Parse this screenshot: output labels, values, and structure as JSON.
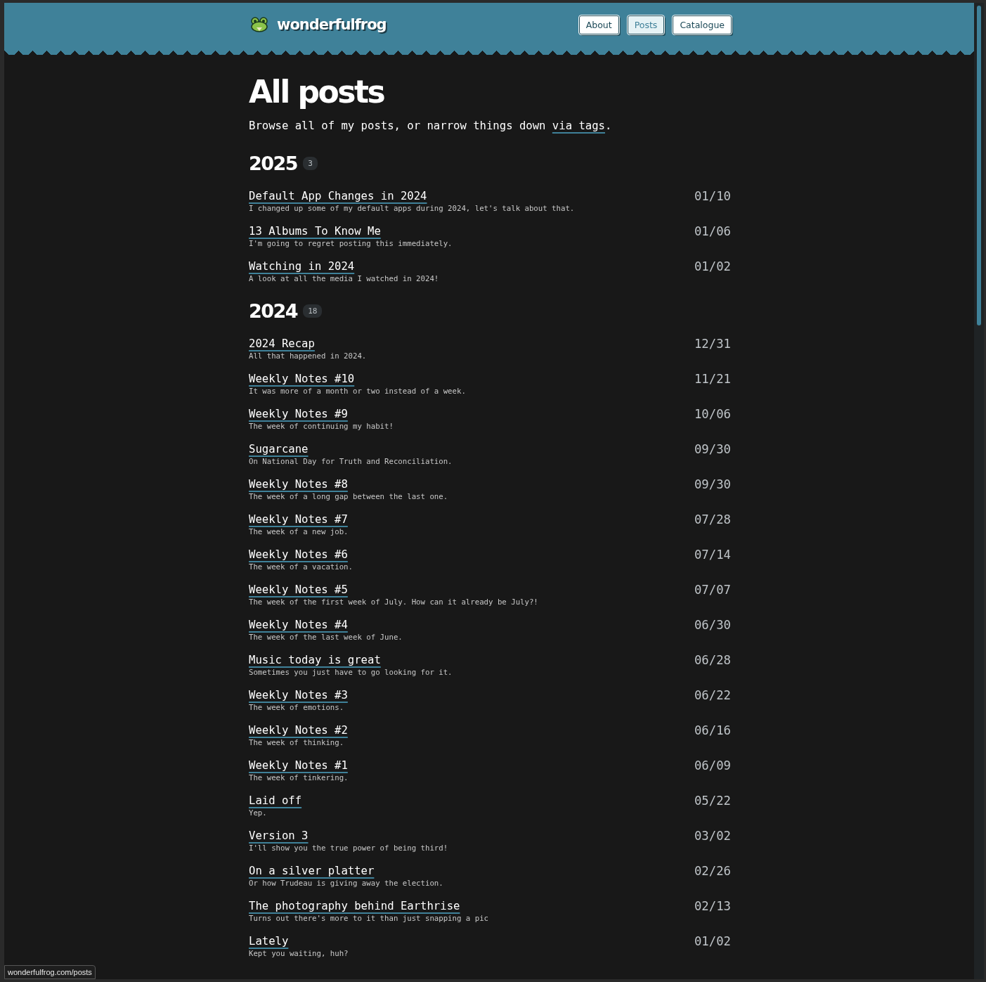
{
  "site": {
    "name": "wonderfulfrog"
  },
  "nav": [
    {
      "label": "About",
      "selected": false
    },
    {
      "label": "Posts",
      "selected": true
    },
    {
      "label": "Catalogue",
      "selected": false
    }
  ],
  "title": "All posts",
  "intro": {
    "text": "Browse all of my posts, or narrow things down ",
    "link": "via tags",
    "after": "."
  },
  "years": [
    {
      "year": "2025",
      "count": "3",
      "posts": [
        {
          "title": "Default App Changes in 2024",
          "description": "I changed up some of my default apps during 2024, let's talk about that.",
          "date": "01/10"
        },
        {
          "title": "13 Albums To Know Me",
          "description": "I'm going to regret posting this immediately.",
          "date": "01/06"
        },
        {
          "title": "Watching in 2024",
          "description": "A look at all the media I watched in 2024!",
          "date": "01/02"
        }
      ]
    },
    {
      "year": "2024",
      "count": "18",
      "posts": [
        {
          "title": "2024 Recap",
          "description": "All that happened in 2024.",
          "date": "12/31"
        },
        {
          "title": "Weekly Notes #10",
          "description": "It was more of a month or two instead of a week.",
          "date": "11/21"
        },
        {
          "title": "Weekly Notes #9",
          "description": "The week of continuing my habit!",
          "date": "10/06"
        },
        {
          "title": "Sugarcane",
          "description": "On National Day for Truth and Reconciliation.",
          "date": "09/30"
        },
        {
          "title": "Weekly Notes #8",
          "description": "The week of a long gap between the last one.",
          "date": "09/30"
        },
        {
          "title": "Weekly Notes #7",
          "description": "The week of a new job.",
          "date": "07/28"
        },
        {
          "title": "Weekly Notes #6",
          "description": "The week of a vacation.",
          "date": "07/14"
        },
        {
          "title": "Weekly Notes #5",
          "description": "The week of the first week of July. How can it already be July?!",
          "date": "07/07"
        },
        {
          "title": "Weekly Notes #4",
          "description": "The week of the last week of June.",
          "date": "06/30"
        },
        {
          "title": "Music today is great",
          "description": "Sometimes you just have to go looking for it.",
          "date": "06/28"
        },
        {
          "title": "Weekly Notes #3",
          "description": "The week of emotions.",
          "date": "06/22"
        },
        {
          "title": "Weekly Notes #2",
          "description": "The week of thinking.",
          "date": "06/16"
        },
        {
          "title": "Weekly Notes #1",
          "description": "The week of tinkering.",
          "date": "06/09"
        },
        {
          "title": "Laid off",
          "description": "Yep.",
          "date": "05/22"
        },
        {
          "title": "Version 3",
          "description": "I'll show you the true power of being third!",
          "date": "03/02"
        },
        {
          "title": "On a silver platter",
          "description": "Or how Trudeau is giving away the election.",
          "date": "02/26"
        },
        {
          "title": "The photography behind Earthrise",
          "description": "Turns out there's more to it than just snapping a pic",
          "date": "02/13"
        },
        {
          "title": "Lately",
          "description": "Kept you waiting, huh?",
          "date": "01/02"
        }
      ]
    }
  ],
  "status_bar": "wonderfulfrog.com/posts"
}
